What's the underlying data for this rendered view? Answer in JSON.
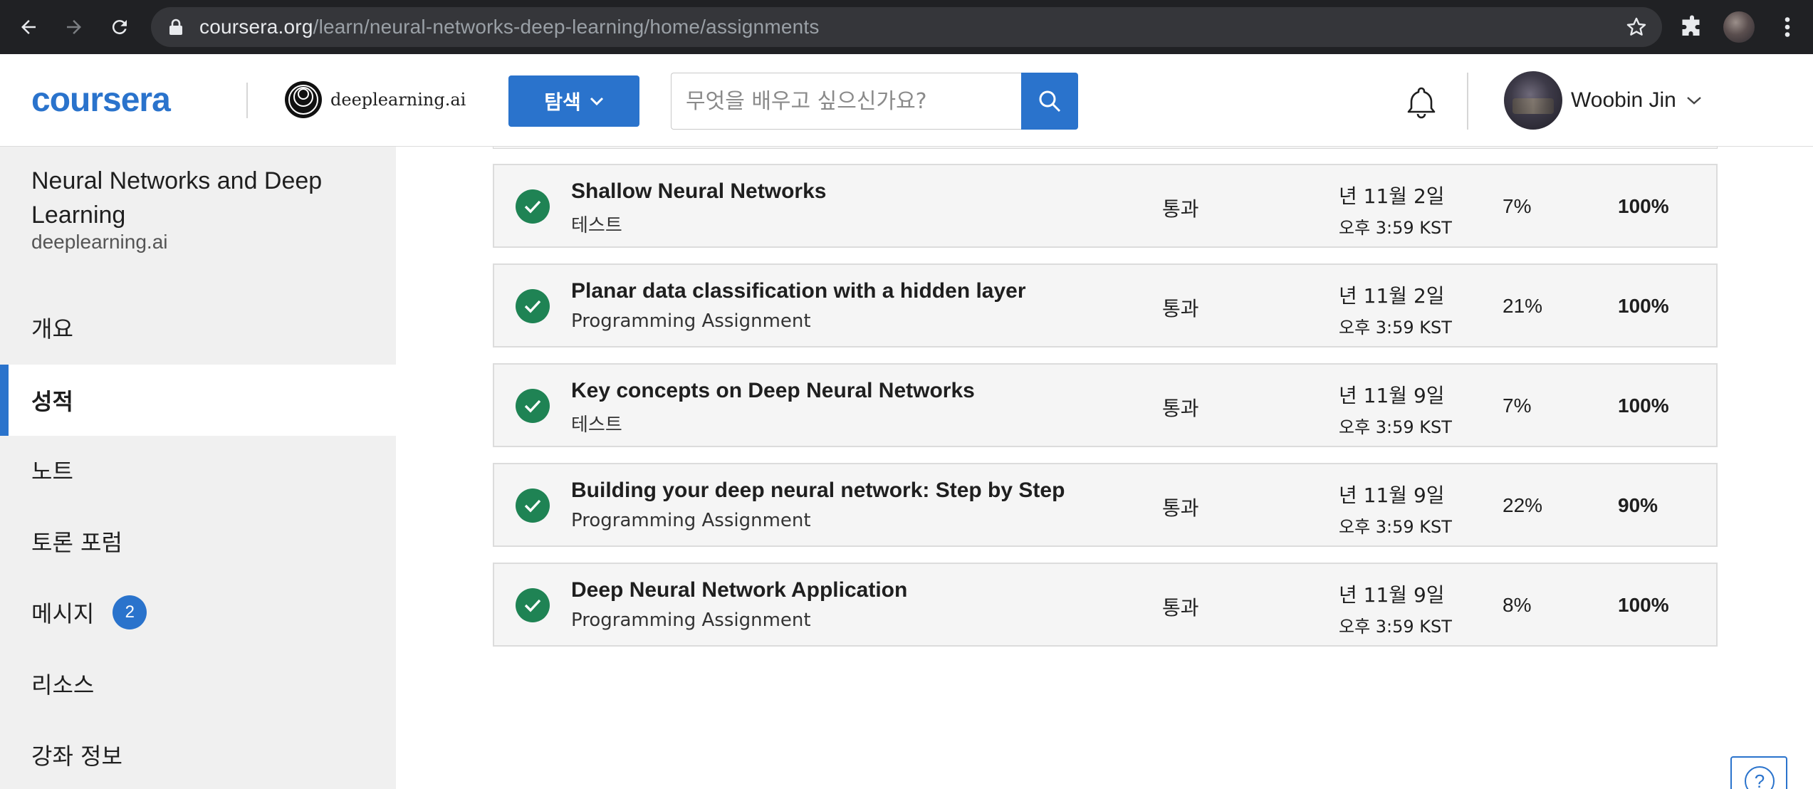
{
  "browser": {
    "url_host": "coursera.org",
    "url_path": "/learn/neural-networks-deep-learning/home/assignments"
  },
  "header": {
    "logo_text": "coursera",
    "partner_name": "deeplearning.ai",
    "explore_label": "탐색",
    "search_placeholder": "무엇을 배우고 싶으신가요?",
    "user_name": "Woobin Jin"
  },
  "sidebar": {
    "course_title": "Neural Networks and Deep Learning",
    "course_org": "deeplearning.ai",
    "items": [
      {
        "label": "개요"
      },
      {
        "label": "성적",
        "active": true
      },
      {
        "label": "노트"
      },
      {
        "label": "토론 포럼"
      },
      {
        "label": "메시지",
        "badge": "2"
      },
      {
        "label": "리소스"
      },
      {
        "label": "강좌 정보"
      }
    ]
  },
  "assignments": [
    {
      "name": "Shallow Neural Networks",
      "type": "테스트",
      "status": "통과",
      "due_date": "년 11월 2일",
      "due_time": "오후 3:59 KST",
      "weight": "7%",
      "grade": "100%"
    },
    {
      "name": "Planar data classification with a hidden layer",
      "type": "Programming Assignment",
      "status": "통과",
      "due_date": "년 11월 2일",
      "due_time": "오후 3:59 KST",
      "weight": "21%",
      "grade": "100%"
    },
    {
      "name": "Key concepts on Deep Neural Networks",
      "type": "테스트",
      "status": "통과",
      "due_date": "년 11월 9일",
      "due_time": "오후 3:59 KST",
      "weight": "7%",
      "grade": "100%"
    },
    {
      "name": "Building your deep neural network: Step by Step",
      "type": "Programming Assignment",
      "status": "통과",
      "due_date": "년 11월 9일",
      "due_time": "오후 3:59 KST",
      "weight": "22%",
      "grade": "90%"
    },
    {
      "name": "Deep Neural Network Application",
      "type": "Programming Assignment",
      "status": "통과",
      "due_date": "년 11월 9일",
      "due_time": "오후 3:59 KST",
      "weight": "8%",
      "grade": "100%"
    }
  ],
  "help": {
    "label": "?"
  },
  "colors": {
    "brand_blue": "#2a73cc",
    "pass_green": "#1f8354",
    "sidebar_bg": "#f0f0f0",
    "chrome_bg": "#202124"
  },
  "icons": [
    "back-icon",
    "forward-icon",
    "reload-icon",
    "lock-icon",
    "star-icon",
    "extensions-icon",
    "chevron-down-icon",
    "search-icon",
    "bell-icon",
    "check-icon",
    "help-icon"
  ]
}
